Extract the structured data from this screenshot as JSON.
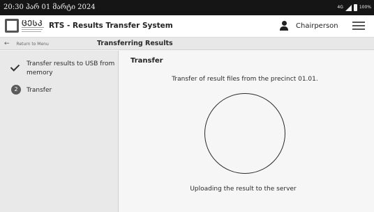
{
  "status_bar": {
    "time": "20:30 პარ 01 მარტი 2024",
    "network": "4G",
    "battery": "100%"
  },
  "header": {
    "logo_text": "ᲪᲔᲡᲙ",
    "title": "RTS - Results Transfer System",
    "user_role": "Chairperson"
  },
  "navbar": {
    "back_label": "Return to Menu",
    "screen_title": "Transferring Results"
  },
  "steps": [
    {
      "label": "Transfer results to USB from memory",
      "state": "done"
    },
    {
      "number": "2",
      "label": "Transfer",
      "state": "current"
    }
  ],
  "main": {
    "title": "Transfer",
    "description": "Transfer of result files from the precinct 01.01.",
    "status": "Uploading the result to the server"
  },
  "colors": {
    "status_bar_bg": "#151515",
    "sidebar_bg": "#e9e9e9",
    "content_bg": "#f6f6f6",
    "step_number_bg": "#5a5a5a"
  }
}
